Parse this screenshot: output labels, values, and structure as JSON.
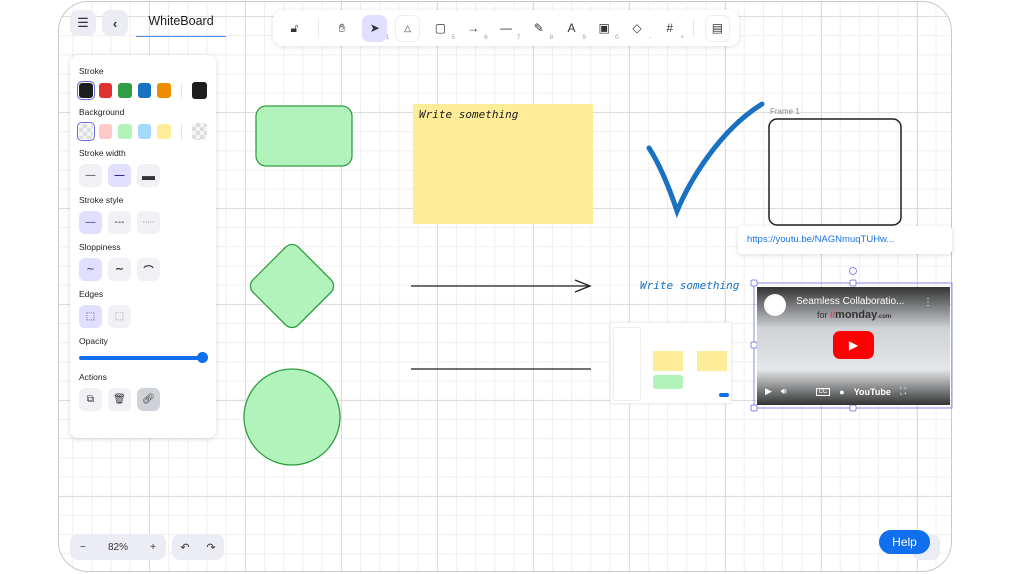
{
  "header": {
    "title": "WhiteBoard",
    "menu_icon": "hamburger-icon",
    "back_icon": "chevron-left-icon"
  },
  "toolbar": {
    "tools": [
      {
        "name": "lock",
        "icon": "lock-icon",
        "key": ""
      },
      {
        "name": "hand",
        "icon": "hand-icon",
        "key": ""
      },
      {
        "name": "selection",
        "icon": "cursor-icon",
        "key": "1"
      },
      {
        "name": "shapes",
        "icon": "shapes-icon",
        "key": ""
      },
      {
        "name": "sticky-note",
        "icon": "sticky-note-icon",
        "key": "5"
      },
      {
        "name": "arrow",
        "icon": "arrow-icon",
        "key": "6"
      },
      {
        "name": "line",
        "icon": "line-icon",
        "key": "7"
      },
      {
        "name": "pencil",
        "icon": "pencil-icon",
        "key": "8"
      },
      {
        "name": "text",
        "icon": "text-icon",
        "key": "9"
      },
      {
        "name": "image",
        "icon": "image-icon",
        "key": "0"
      },
      {
        "name": "eraser",
        "icon": "eraser-icon",
        "key": "-"
      },
      {
        "name": "frame",
        "icon": "frame-icon",
        "key": "+"
      },
      {
        "name": "library",
        "icon": "library-icon",
        "key": ""
      }
    ]
  },
  "panel": {
    "stroke_label": "Stroke",
    "stroke_colors": [
      "#1e1e1e",
      "#e03131",
      "#2f9e44",
      "#1971c2",
      "#f08c00"
    ],
    "stroke_current": "#1e1e1e",
    "background_label": "Background",
    "background_colors": [
      "transparent",
      "#ffc9c9",
      "#b2f2bb",
      "#a5d8ff",
      "#ffec99"
    ],
    "stroke_width_label": "Stroke width",
    "stroke_style_label": "Stroke style",
    "sloppiness_label": "Sloppiness",
    "edges_label": "Edges",
    "opacity_label": "Opacity",
    "opacity": 100,
    "actions_label": "Actions"
  },
  "canvas": {
    "sticky_text": "Write something",
    "frame_label": "Frame 1",
    "handwritten_text": "Write something",
    "link_url": "https://youtu.be/NAGNmuqTUHw...",
    "video": {
      "title": "Seamless Collaboratio...",
      "brand_for": "for",
      "brand": "monday",
      "brand_suffix": ".com",
      "platform": "YouTube",
      "cc": "CC"
    },
    "shape_fill": "#b2f2bb",
    "shape_stroke": "#2f9e44",
    "accent": "#6965db"
  },
  "footer": {
    "zoom": "82%",
    "zoom_out": "−",
    "zoom_in": "+",
    "undo_icon": "undo-icon",
    "redo_icon": "redo-icon",
    "help": "Help"
  }
}
